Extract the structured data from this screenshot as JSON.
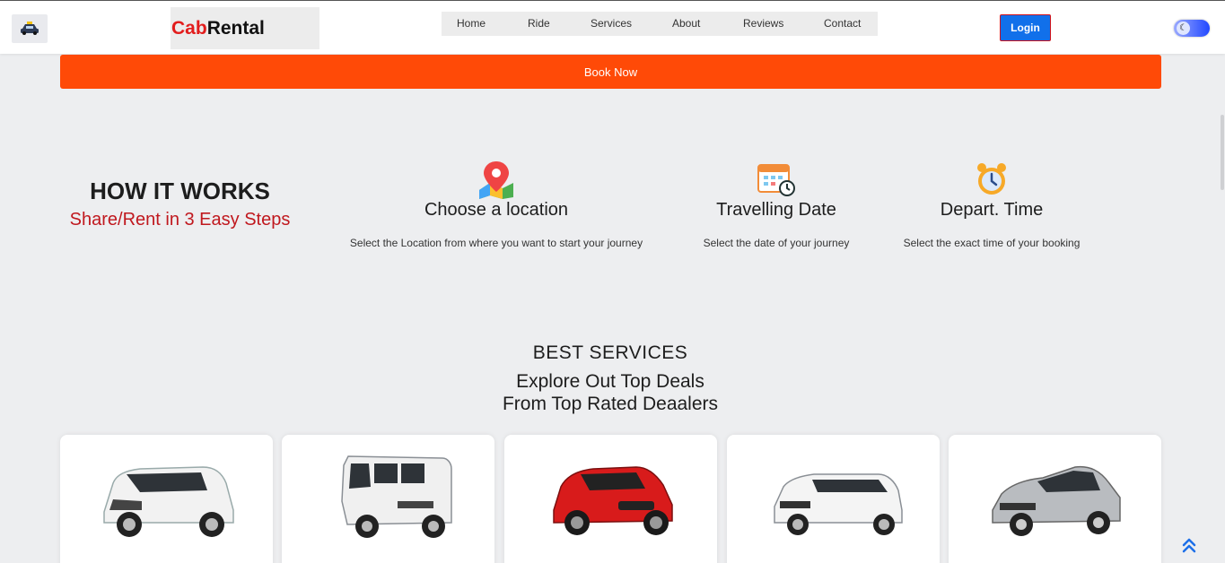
{
  "header": {
    "brand_part1": "Cab",
    "brand_part2": "Rental",
    "nav": [
      "Home",
      "Ride",
      "Services",
      "About",
      "Reviews",
      "Contact"
    ],
    "login_label": "Login"
  },
  "book_now_label": "Book Now",
  "how_it_works": {
    "title": "HOW IT WORKS",
    "subtitle": "Share/Rent in 3 Easy Steps",
    "steps": [
      {
        "title": "Choose a location",
        "desc": "Select the Location from where you want to start your journey",
        "icon": "map-pin-icon"
      },
      {
        "title": "Travelling Date",
        "desc": "Select the date of your journey",
        "icon": "calendar-icon"
      },
      {
        "title": "Depart. Time",
        "desc": "Select the exact time of your booking",
        "icon": "alarm-clock-icon"
      }
    ]
  },
  "best_services": {
    "title": "BEST SERVICES",
    "subtitle_line1": "Explore Out Top Deals",
    "subtitle_line2": "From Top Rated Deaalers"
  },
  "cars": [
    {
      "name": "white-mpv",
      "color": "#f2f2f2"
    },
    {
      "name": "white-van",
      "color": "#f2f2f2"
    },
    {
      "name": "red-hatchback",
      "color": "#d81b1b"
    },
    {
      "name": "white-suv",
      "color": "#f4f4f4"
    },
    {
      "name": "silver-sedan",
      "color": "#b9bcc0"
    }
  ],
  "colors": {
    "accent": "#ff4a07",
    "brand_red": "#e21d1d",
    "login_blue": "#1170ea"
  }
}
